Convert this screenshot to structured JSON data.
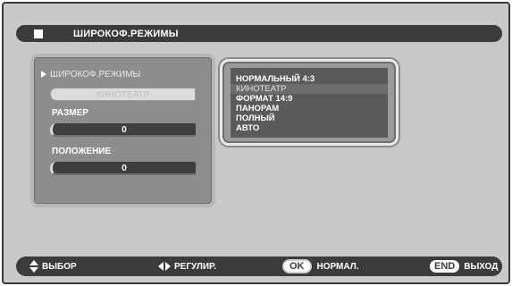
{
  "title": "ШИРОКОФ.РЕЖИМЫ",
  "left_panel": {
    "mode_label": "ШИРОКОФ.РЕЖИМЫ",
    "mode_value": "КИНОТЕАТР",
    "size_label": "РАЗМЕР",
    "size_value": "0",
    "position_label": "ПОЛОЖЕНИЕ",
    "position_value": "0"
  },
  "list": {
    "items": [
      "НОРМАЛЬНЫЙ 4:3",
      "КИНОТЕАТР",
      "ФОРМАТ 14:9",
      "ПАНОРАМ",
      "ПОЛНЫЙ",
      "АВТО"
    ],
    "selected_index": 1
  },
  "footer": {
    "select_label": "ВЫБОР",
    "adjust_label": "РЕГУЛИР.",
    "ok_key": "OK",
    "ok_label": "НОРМАЛ.",
    "end_key": "END",
    "end_label": "ВЫХОД"
  },
  "icons": [
    "up-down-arrows-icon",
    "left-right-arrows-icon",
    "selection-arrow-icon"
  ]
}
